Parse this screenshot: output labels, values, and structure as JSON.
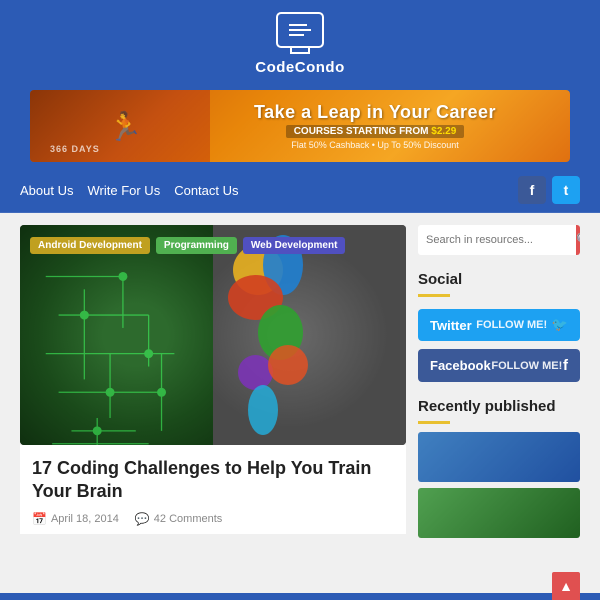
{
  "header": {
    "logo_icon_label": "monitor-icon",
    "logo_text": "CodeCondo"
  },
  "ad": {
    "title": "Take a Leap in Your Career",
    "subtitle_start": "COURSES STARTING FROM ",
    "subtitle_price": "$2.29",
    "bottom_text": "Flat 50% Cashback • Up To 50% Discount",
    "days_label": "366 DAYS"
  },
  "nav": {
    "links": [
      {
        "label": "About Us",
        "id": "about-us"
      },
      {
        "label": "Write For Us",
        "id": "write-for-us"
      },
      {
        "label": "Contact Us",
        "id": "contact-us"
      }
    ],
    "social": {
      "facebook_label": "f",
      "twitter_label": "t"
    }
  },
  "article": {
    "tags": [
      {
        "label": "Android Development",
        "type": "android"
      },
      {
        "label": "Programming",
        "type": "programming"
      },
      {
        "label": "Web Development",
        "type": "web"
      }
    ],
    "title": "17 Coding Challenges to Help You Train Your Brain",
    "date": "April 18, 2014",
    "comments": "42 Comments"
  },
  "sidebar": {
    "search_placeholder": "Search in resources...",
    "search_btn_icon": "🔍",
    "social_section_title": "Social",
    "twitter_label": "Twitter",
    "twitter_sub": "FOLLOW ME!",
    "twitter_icon": "🐦",
    "facebook_label": "Facebook",
    "facebook_sub": "FOLLOW ME!",
    "facebook_icon": "f",
    "recently_title": "Recently published"
  },
  "scroll_top_icon": "▲"
}
